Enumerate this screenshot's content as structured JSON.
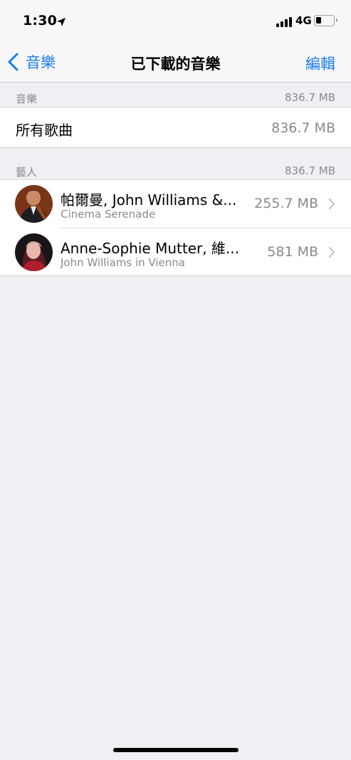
{
  "status": {
    "time": "1:30",
    "location_icon": "location-arrow-icon",
    "network": "4G",
    "battery_fraction": 0.3
  },
  "nav": {
    "back_label": "音樂",
    "title": "已下載的音樂",
    "edit_label": "編輯"
  },
  "music_section": {
    "label": "音樂",
    "size": "836.7 MB"
  },
  "all_songs": {
    "label": "所有歌曲",
    "size": "836.7 MB"
  },
  "artists_section": {
    "label": "藝人",
    "size": "836.7 MB"
  },
  "artists": [
    {
      "name": "帕爾曼, John Williams &...",
      "album": "Cinema Serenade",
      "size": "255.7 MB"
    },
    {
      "name": "Anne-Sophie Mutter, 維...",
      "album": "John Williams in Vienna",
      "size": "581 MB"
    }
  ],
  "colors": {
    "accent": "#1a7cf0",
    "background": "#efeff4",
    "secondary_text": "#8a8a8e"
  }
}
